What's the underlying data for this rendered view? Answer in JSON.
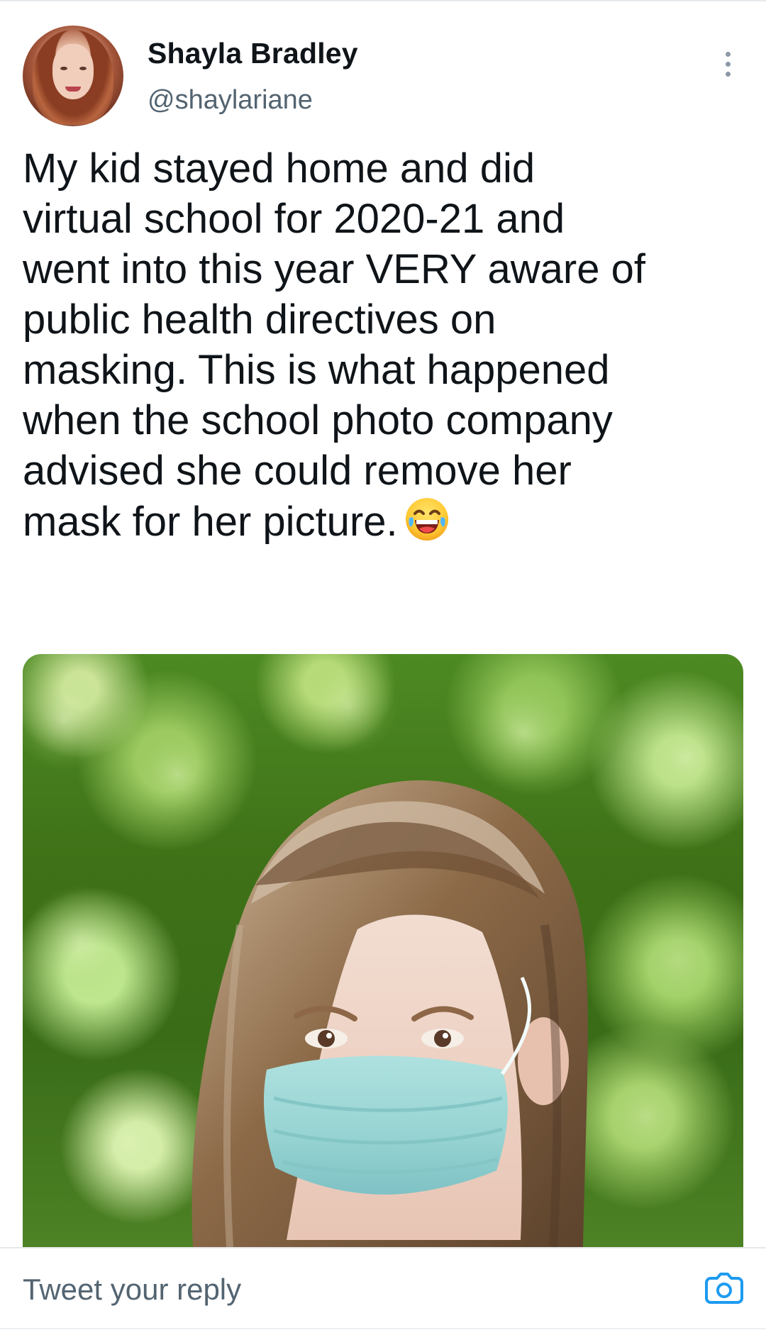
{
  "author": {
    "display_name": "Shayla Bradley",
    "handle": "@shaylariane"
  },
  "tweet": {
    "text_lines": [
      "My kid stayed home and did",
      "virtual school for 2020-21 and",
      "went into this year VERY aware of",
      "public health directives on",
      "masking. This is what happened",
      "when the school photo company",
      "advised she could remove her",
      "mask for her picture."
    ],
    "emoji": "face-with-tears-of-joy",
    "media": "photo of a girl with long brown hair wearing a light blue surgical mask, frowning, in front of green foliage"
  },
  "reply": {
    "placeholder": "Tweet your reply"
  },
  "icons": {
    "more": "more-vertical-icon",
    "camera": "camera-icon"
  },
  "colors": {
    "text": "#0f1419",
    "secondary_text": "#536471",
    "accent": "#1d9bf0",
    "divider": "#e6e9ec",
    "mask": "#9ad8d6"
  }
}
